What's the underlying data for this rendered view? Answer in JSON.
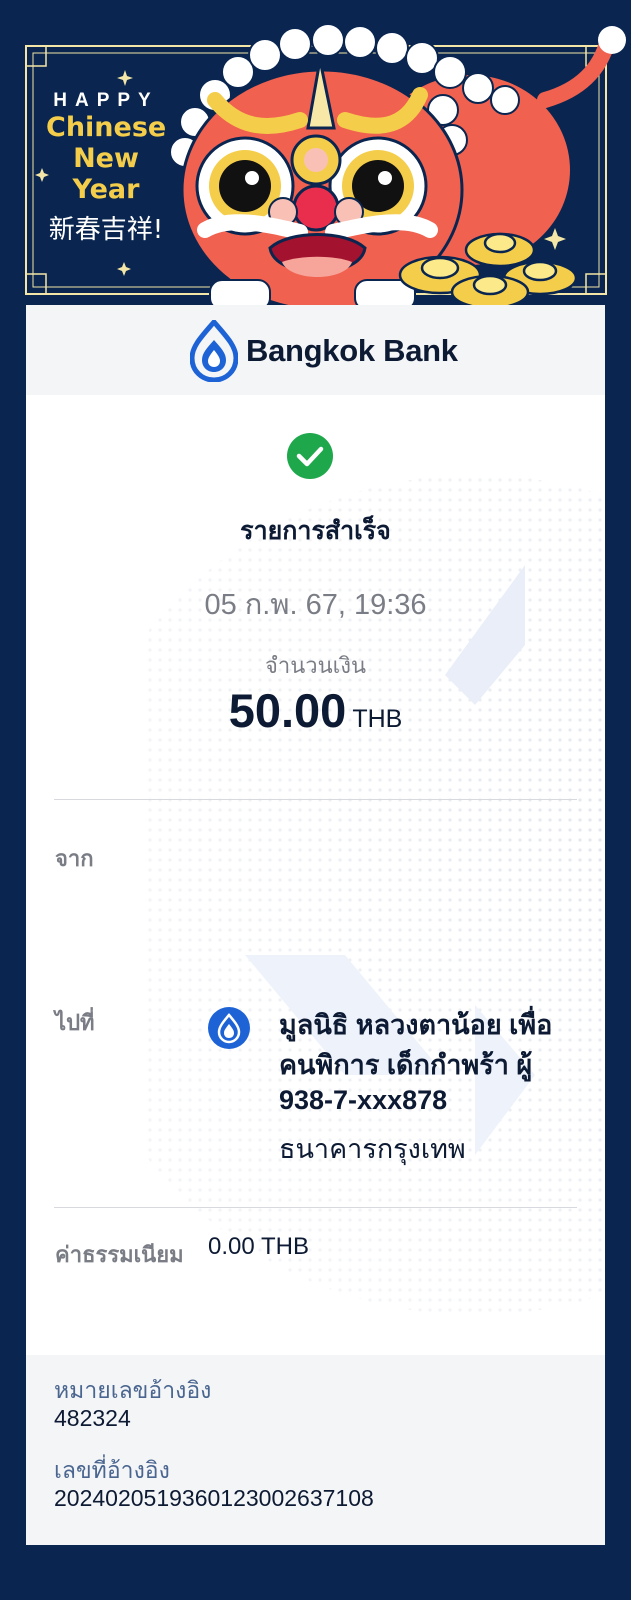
{
  "banner": {
    "happy": "HAPPY",
    "line2": "Chinese",
    "line3": "New",
    "line4": "Year",
    "chinese": "新春吉祥!"
  },
  "brand": {
    "name": "Bangkok Bank",
    "color": "#1e63d6"
  },
  "status": {
    "icon": "check-circle-icon",
    "text": "รายการสำเร็จ",
    "color": "#1ea84b"
  },
  "datetime": "05 ก.พ. 67, 19:36",
  "amount": {
    "label": "จำนวนเงิน",
    "value": "50.00",
    "currency": "THB"
  },
  "from": {
    "label": "จาก"
  },
  "to": {
    "label": "ไปที่",
    "name": "มูลนิธิ หลวงตาน้อย เพื่อคนพิการ เด็กกำพร้า ผู้",
    "account": "938-7-xxx878",
    "bank": "ธนาคารกรุงเทพ"
  },
  "fee": {
    "label": "ค่าธรรมเนียม",
    "value": "0.00 THB"
  },
  "footer": {
    "ref_label": "หมายเลขอ้างอิง",
    "ref_value": "482324",
    "ref2_label": "เลขที่อ้างอิง",
    "ref2_value": "2024020519360123002637108"
  },
  "colors": {
    "background": "#0a2650",
    "banner_red": "#f0614f",
    "gold": "#f4cd4b"
  }
}
